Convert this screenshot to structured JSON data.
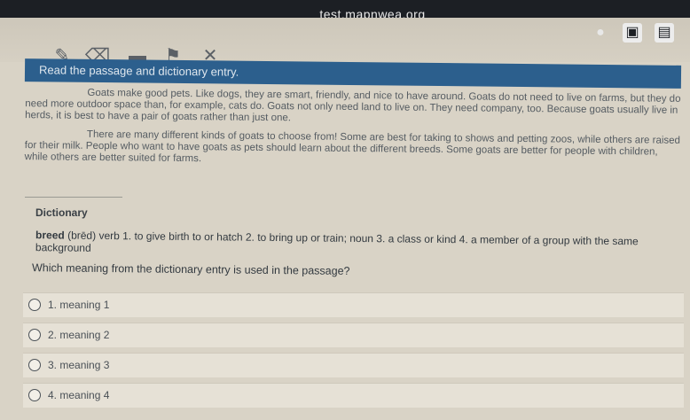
{
  "browser": {
    "url": "test.mapnwea.org"
  },
  "toolbar": {
    "tools": [
      {
        "icon": "highlighter-icon"
      },
      {
        "icon": "eraser-icon"
      },
      {
        "icon": "answer-masking-icon"
      },
      {
        "icon": "flag-icon"
      },
      {
        "icon": "strikethrough-icon"
      }
    ],
    "right_icons": [
      "audio-icon",
      "tools-icon",
      "menu-icon"
    ]
  },
  "banner": {
    "text": "Read the passage and dictionary entry."
  },
  "passage": {
    "paragraphs": [
      "Goats make good pets. Like dogs, they are smart, friendly, and nice to have around. Goats do not need to live on farms, but they do need more outdoor space than, for example, cats do. Goats not only need land to live on. They need company, too. Because goats usually live in herds, it is best to have a pair of goats rather than just one.",
      "There are many different kinds of goats to choose from! Some are best for taking to shows and petting zoos, while others are raised for their milk. People who want to have goats as pets should learn about the different breeds. Some goats are better for people with children, while others are better suited for farms."
    ]
  },
  "dictionary": {
    "title": "Dictionary",
    "word": "breed",
    "pronunciation": "(brēd)",
    "definition": "verb 1. to give birth to or hatch 2. to bring up or train; noun 3. a class or kind 4. a member of a group with the same background"
  },
  "question": {
    "text": "Which meaning from the dictionary entry is used in the passage?",
    "choices": [
      {
        "number": "1.",
        "label": "meaning 1"
      },
      {
        "number": "2.",
        "label": "meaning 2"
      },
      {
        "number": "3.",
        "label": "meaning 3"
      },
      {
        "number": "4.",
        "label": "meaning 4"
      }
    ]
  },
  "colors": {
    "banner_bg": "#2c5f8d",
    "topbar_bg": "#1c1f24",
    "page_bg": "#d9d3c6"
  }
}
